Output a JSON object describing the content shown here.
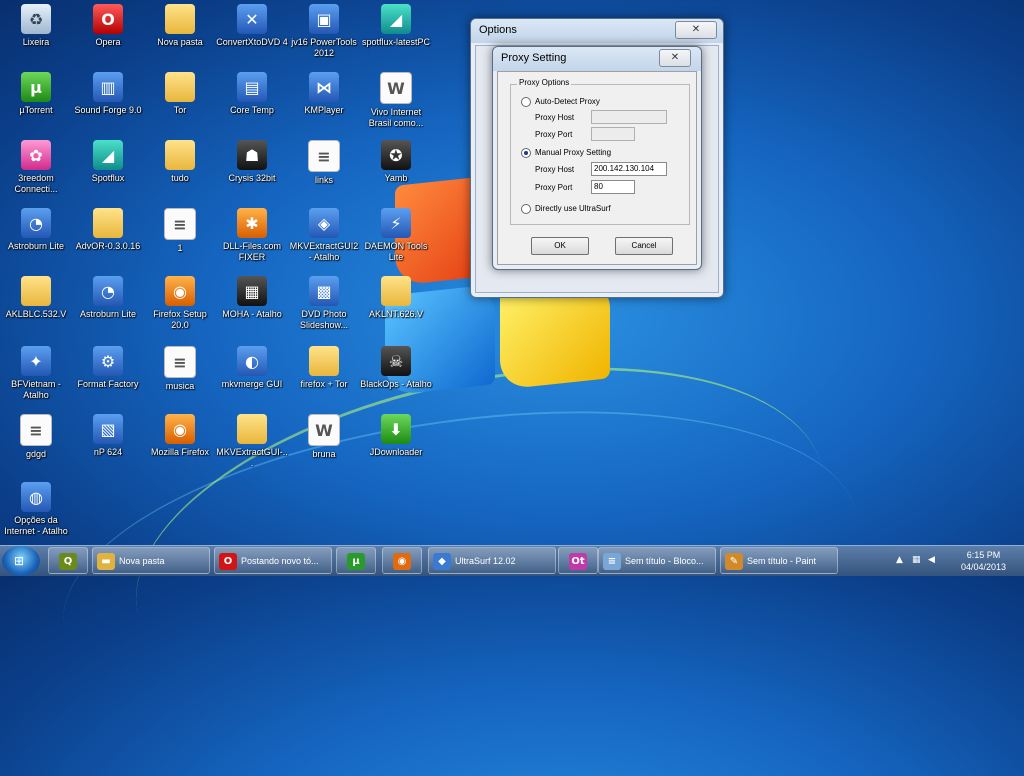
{
  "desktop": {
    "icons": [
      {
        "label": "Lixeira",
        "glyph": "recycle-bin-icon",
        "symbol": "♻"
      },
      {
        "label": "Opera",
        "glyph": "opera-icon",
        "symbol": "O"
      },
      {
        "label": "Nova pasta",
        "glyph": "folder-icon",
        "symbol": ""
      },
      {
        "label": "ConvertXtoDVD 4",
        "glyph": "convertxtodvd-icon",
        "symbol": "✕"
      },
      {
        "label": "jv16 PowerTools 2012",
        "glyph": "jv16-icon",
        "symbol": "▣"
      },
      {
        "label": "spotflux-latestPC",
        "glyph": "spotflux-icon",
        "symbol": "◢"
      },
      {
        "label": "µTorrent",
        "glyph": "utorrent-icon",
        "symbol": "µ"
      },
      {
        "label": "Sound Forge 9.0",
        "glyph": "sound-forge-icon",
        "symbol": "▥"
      },
      {
        "label": "Tor",
        "glyph": "folder-icon",
        "symbol": ""
      },
      {
        "label": "Core Temp",
        "glyph": "core-temp-icon",
        "symbol": "▤"
      },
      {
        "label": "KMPlayer",
        "glyph": "kmplayer-icon",
        "symbol": "⋈"
      },
      {
        "label": "Vivo Internet Brasil como...",
        "glyph": "word-document-icon",
        "symbol": "W"
      },
      {
        "label": "3reedom Connecti...",
        "glyph": "freedom-icon",
        "symbol": "✿"
      },
      {
        "label": "Spotflux",
        "glyph": "spotflux-icon",
        "symbol": "◢"
      },
      {
        "label": "tudo",
        "glyph": "folder-icon",
        "symbol": ""
      },
      {
        "label": "Crysis 32bit",
        "glyph": "crysis-icon",
        "symbol": "☗"
      },
      {
        "label": "links",
        "glyph": "text-file-icon",
        "symbol": "≡"
      },
      {
        "label": "Yamb",
        "glyph": "yamb-icon",
        "symbol": "✪"
      },
      {
        "label": "Astroburn Lite",
        "glyph": "astroburn-icon",
        "symbol": "◔"
      },
      {
        "label": "AdvOR-0.3.0.16",
        "glyph": "folder-icon",
        "symbol": ""
      },
      {
        "label": "1",
        "glyph": "text-file-icon",
        "symbol": "≡"
      },
      {
        "label": "DLL-Files.com FIXER",
        "glyph": "dll-fixer-icon",
        "symbol": "✱"
      },
      {
        "label": "MKVExtractGUI2 - Atalho",
        "glyph": "mkvextract-icon",
        "symbol": "◈"
      },
      {
        "label": "DAEMON Tools Lite",
        "glyph": "daemon-tools-icon",
        "symbol": "⚡"
      },
      {
        "label": "AKLBLC.532.V",
        "glyph": "folder-icon",
        "symbol": ""
      },
      {
        "label": "Astroburn Lite",
        "glyph": "astroburn-icon",
        "symbol": "◔"
      },
      {
        "label": "Firefox Setup 20.0",
        "glyph": "firefox-setup-icon",
        "symbol": "◉"
      },
      {
        "label": "MOHA - Atalho",
        "glyph": "moha-icon",
        "symbol": "▦"
      },
      {
        "label": "DVD Photo Slideshow...",
        "glyph": "dvd-slideshow-icon",
        "symbol": "▩"
      },
      {
        "label": "AKLNT.626.V",
        "glyph": "folder-icon",
        "symbol": ""
      },
      {
        "label": "BFVietnam - Atalho",
        "glyph": "bfvietnam-icon",
        "symbol": "✦"
      },
      {
        "label": "Format Factory",
        "glyph": "format-factory-icon",
        "symbol": "⚙"
      },
      {
        "label": "musica",
        "glyph": "text-file-icon",
        "symbol": "≡"
      },
      {
        "label": "mkvmerge GUI",
        "glyph": "mkvmerge-icon",
        "symbol": "◐"
      },
      {
        "label": "firefox + Tor",
        "glyph": "folder-icon",
        "symbol": ""
      },
      {
        "label": "BlackOps - Atalho",
        "glyph": "blackops-icon",
        "symbol": "☠"
      },
      {
        "label": "gdgd",
        "glyph": "text-file-icon",
        "symbol": "≡"
      },
      {
        "label": "nP 624",
        "glyph": "winrar-icon",
        "symbol": "▧"
      },
      {
        "label": "Mozilla Firefox",
        "glyph": "firefox-icon",
        "symbol": "◉"
      },
      {
        "label": "MKVExtractGUI-...",
        "glyph": "folder-icon",
        "symbol": ""
      },
      {
        "label": "bruna",
        "glyph": "word-document-icon",
        "symbol": "W"
      },
      {
        "label": "JDownloader",
        "glyph": "jdownloader-icon",
        "symbol": "⬇"
      },
      {
        "label": "Opções da Internet - Atalho",
        "glyph": "internet-options-icon",
        "symbol": "◍"
      }
    ]
  },
  "options_window": {
    "title": "Options",
    "close_glyph": "✕"
  },
  "proxy_dialog": {
    "title": "Proxy Setting",
    "close_glyph": "✕",
    "group_title": "Proxy Options",
    "auto_detect_label": "Auto-Detect Proxy",
    "auto_host_label": "Proxy Host",
    "auto_port_label": "Proxy Port",
    "auto_host_value": "",
    "auto_port_value": "",
    "manual_label": "Manual Proxy Setting",
    "manual_host_label": "Proxy Host",
    "manual_port_label": "Proxy Port",
    "manual_host_value": "200.142.130.104",
    "manual_port_value": "80",
    "direct_label": "Directly use UltraSurf",
    "selected": "manual",
    "ok_label": "OK",
    "cancel_label": "Cancel"
  },
  "taskbar": {
    "items": [
      {
        "label": "",
        "name": "taskbar-pinned-quicktime",
        "symbol": "Q",
        "color": "#6a8a1a"
      },
      {
        "label": "Nova pasta",
        "name": "taskbar-item-nova-pasta",
        "symbol": "▬",
        "color": "#e0b340"
      },
      {
        "label": "Postando novo tó...",
        "name": "taskbar-item-opera",
        "symbol": "O",
        "color": "#d21414"
      },
      {
        "label": "",
        "name": "taskbar-pinned-utorrent",
        "symbol": "µ",
        "color": "#2a9a2a"
      },
      {
        "label": "",
        "name": "taskbar-pinned-firefox",
        "symbol": "◉",
        "color": "#e06a10"
      },
      {
        "label": "UltraSurf 12.02",
        "name": "taskbar-item-ultrasurf",
        "symbol": "◆",
        "color": "#3a7ad0"
      },
      {
        "label": "",
        "name": "taskbar-pinned-ot",
        "symbol": "Ot",
        "color": "#c03aa8"
      },
      {
        "label": "Sem título - Bloco...",
        "name": "taskbar-item-notepad",
        "symbol": "≡",
        "color": "#7aa6d6"
      },
      {
        "label": "Sem título - Paint",
        "name": "taskbar-item-paint",
        "symbol": "✎",
        "color": "#d08a2a"
      }
    ],
    "clock_time": "6:15 PM",
    "clock_date": "04/04/2013"
  }
}
